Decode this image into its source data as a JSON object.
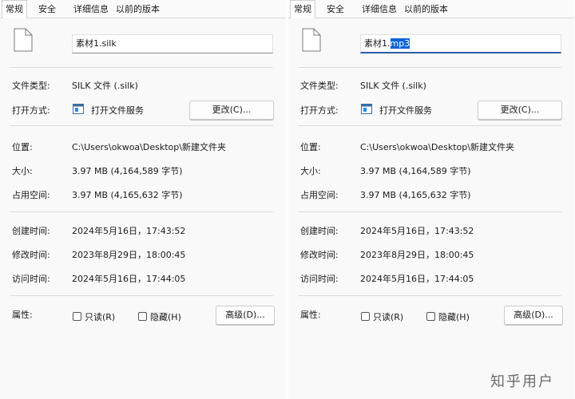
{
  "tabs": [
    "常规",
    "安全",
    "详细信息",
    "以前的版本"
  ],
  "left": {
    "filename": "素材1.silk",
    "file_type": {
      "label": "文件类型:",
      "value": "SILK 文件 (.silk)"
    },
    "opens_with": {
      "label": "打开方式:",
      "value": "打开文件服务",
      "button": "更改(C)..."
    },
    "location": {
      "label": "位置:",
      "value": "C:\\Users\\okwoa\\Desktop\\新建文件夹"
    },
    "size": {
      "label": "大小:",
      "value": "3.97 MB (4,164,589 字节)"
    },
    "size_on_disk": {
      "label": "占用空间:",
      "value": "3.97 MB (4,165,632 字节)"
    },
    "created": {
      "label": "创建时间:",
      "value": "2024年5月16日，17:43:52"
    },
    "modified": {
      "label": "修改时间:",
      "value": "2023年8月29日，18:00:45"
    },
    "accessed": {
      "label": "访问时间:",
      "value": "2024年5月16日，17:44:05"
    },
    "attributes": {
      "label": "属性:",
      "readonly": "只读(R)",
      "hidden": "隐藏(H)",
      "advanced": "高级(D)..."
    }
  },
  "right": {
    "filename_base": "素材1.",
    "filename_selected": "mp3",
    "file_type": {
      "label": "文件类型:",
      "value": "SILK 文件 (.silk)"
    },
    "opens_with": {
      "label": "打开方式:",
      "value": "打开文件服务",
      "button": "更改(C)..."
    },
    "location": {
      "label": "位置:",
      "value": "C:\\Users\\okwoa\\Desktop\\新建文件夹"
    },
    "size": {
      "label": "大小:",
      "value": "3.97 MB (4,164,589 字节)"
    },
    "size_on_disk": {
      "label": "占用空间:",
      "value": "3.97 MB (4,165,632 字节)"
    },
    "created": {
      "label": "创建时间:",
      "value": "2024年5月16日，17:43:52"
    },
    "modified": {
      "label": "修改时间:",
      "value": "2023年8月29日，18:00:45"
    },
    "accessed": {
      "label": "访问时间:",
      "value": "2024年5月16日，17:44:05"
    },
    "attributes": {
      "label": "属性:",
      "readonly": "只读(R)",
      "hidden": "隐藏(H)",
      "advanced": "高级(D)..."
    }
  },
  "watermark": "知乎用户",
  "colors": {
    "selection": "#0b62d6",
    "focus_underline": "#2b5ea7"
  }
}
